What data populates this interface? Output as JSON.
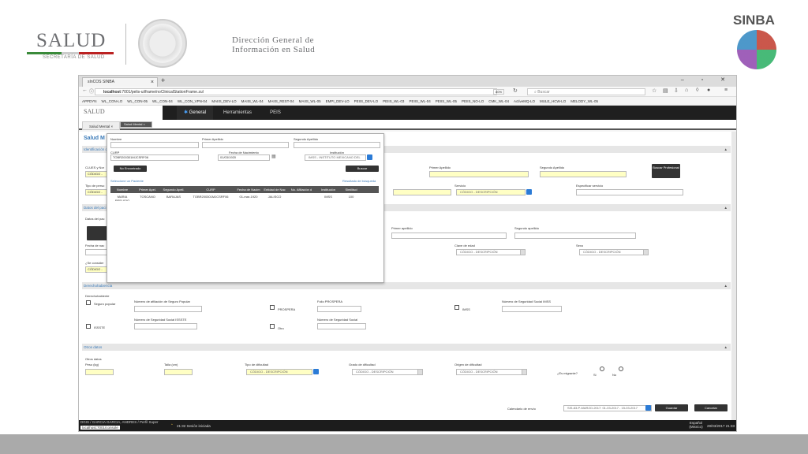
{
  "slide": {
    "salud": "SALUD",
    "salud_sub": "SECRETARÍA DE SALUD",
    "dgis_line1": "Dirección General de",
    "dgis_line2": "Información en Salud",
    "sinba": "SINBA"
  },
  "browser": {
    "tab_title": "sInCOS SINBA",
    "url_host": "localhost",
    "url_path": ":7001/pelis-ui/frame/noClinicalStationFrame.zul",
    "zoom": "80%",
    "search_placeholder": "Buscar",
    "bookmarks": [
      "APPDYN",
      "WL_CON-LO",
      "WL_CON-05",
      "WL_CON-04",
      "WL_CON_VPN-04",
      "MAIIS_DEV-LO",
      "MAIIS_WL-04",
      "MAIIS_REST-04",
      "MAIIS_WL-05",
      "EMPI_DEV-LO",
      "PEIIS_DEV-LO",
      "PEIIS_WL-03",
      "PEIIS_WL-04",
      "PEIIS_WL-05",
      "PEIIS_NO-LO",
      "CMK_WL-04",
      "ActiveMQ-LO",
      "MULE_HCW-LO",
      "MELODY_WL-05"
    ]
  },
  "app": {
    "logo": "SALUD",
    "menu": {
      "general": "General",
      "herramientas": "Herramientas",
      "peis": "PEIS"
    },
    "subtabs": {
      "t1": "Salud Mental",
      "t2": "Salud Mental"
    },
    "page_title": "Salud M",
    "sections": {
      "ident": "Identificación d",
      "datos_pac": "Datos del paci",
      "derecho": "Derechohabiencia",
      "otros": "Otros datos"
    },
    "ident": {
      "clues": "CLUES y Nor",
      "clues_val": "CÓDIGO -",
      "tipo": "Tipo de perso",
      "tipo_val": "CÓDIGO -",
      "primer_apellido": "Primer Apellido",
      "segundo_apellido": "Segundo Apellido",
      "buscar_profesional": "Buscar Profesional",
      "servicio": "Servicio",
      "servicio_val": "CÓDIGO - DESCRIPCIÓN",
      "especificar": "Especificar servicio"
    },
    "paciente": {
      "datos": "Datos del pac",
      "primer_apellido": "Primer apellido",
      "segundo_apellido": "Segundo apellido",
      "fecha": "Fecha de nac",
      "clave_edad": "Clave de edad",
      "clave_edad_val": "CÓDIGO - DESCRIPCIÓN",
      "sexo": "Sexo",
      "sexo_val": "CÓDIGO - DESCRIPCIÓN",
      "considera": "¿Se consider",
      "considera_val": "CÓDIGO -"
    },
    "derecho": {
      "label": "Derechohabiente",
      "seguro": "Seguro popular",
      "afiliacion": "Número de afiliación de Seguro Popular",
      "prospera": "PROSPERA",
      "folio": "Folio PROSPERA",
      "imss": "IMSS",
      "nss_imss": "Número de Seguridad Social IMSS",
      "issste": "ISSSTE",
      "nss_issste": "Número de Seguridad Social ISSSTE",
      "otro": "Otro",
      "nss": "Número de Seguridad Social"
    },
    "otros": {
      "label": "Otros datos",
      "peso": "Peso (kg)",
      "talla": "Talla (cm)",
      "dificultad": "Tipo de dificultad",
      "dificultad_val": "CÓDIGO - DESCRIPCIÓN",
      "grado": "Grado de dificultad",
      "grado_val": "CÓDIGO - DESCRIPCIÓN",
      "origen": "Origen de dificultad",
      "origen_val": "CÓDIGO - DESCRIPCIÓN",
      "migrante": "¿Es migrante?",
      "si": "Si",
      "no": "No"
    },
    "footer": {
      "calendario": "Calendario de envío",
      "calendario_val": "SIS-83-P-MARZO-2017: 01-03-2017 - 15-03-2017",
      "guardar": "Guardar",
      "cancelar": "Cancelar"
    },
    "status": {
      "user": "DGIS / GARCIA GARCIA, ANDRES / Perfil Super",
      "session": "21:32 Sesión iniciada",
      "url": "localhost:7001/console",
      "lang": "Español",
      "region": "(Mexico)",
      "datetime": "28/03/2017 21:33"
    }
  },
  "modal": {
    "nombre": "Nombre",
    "primer_apellido": "Primer Apellido",
    "segundo_apellido": "Segundo Apellido",
    "curp": "CURP",
    "curp_val": "TOBR200301MJCSRF06",
    "fecha": "Fecha de Nacimiento",
    "fecha_val": "01/03/1920",
    "institucion": "Institución",
    "institucion_val": "IMSS - INSTITUTO MEXICANO DEL",
    "no_encontrado": "No Encontrado",
    "buscar": "Buscar",
    "seleccione": "Seleccione un Paciente",
    "resultado": "Resultado de búsqueda",
    "headers": [
      "Nombre",
      "Primer Apel.",
      "Segundo Apell.",
      "CURP",
      "Fecha de Nacim",
      "Entidad de Nac",
      "No. Afiliación d",
      "Institución",
      "Similitud"
    ],
    "rows": [
      [
        "MARIA REFUGIO",
        "TOSCANO",
        "BARAJAS",
        "TOBR200301MJCSRF06",
        "01-mar-1920",
        "JALISCO",
        "",
        "IMSS",
        "100"
      ]
    ]
  }
}
